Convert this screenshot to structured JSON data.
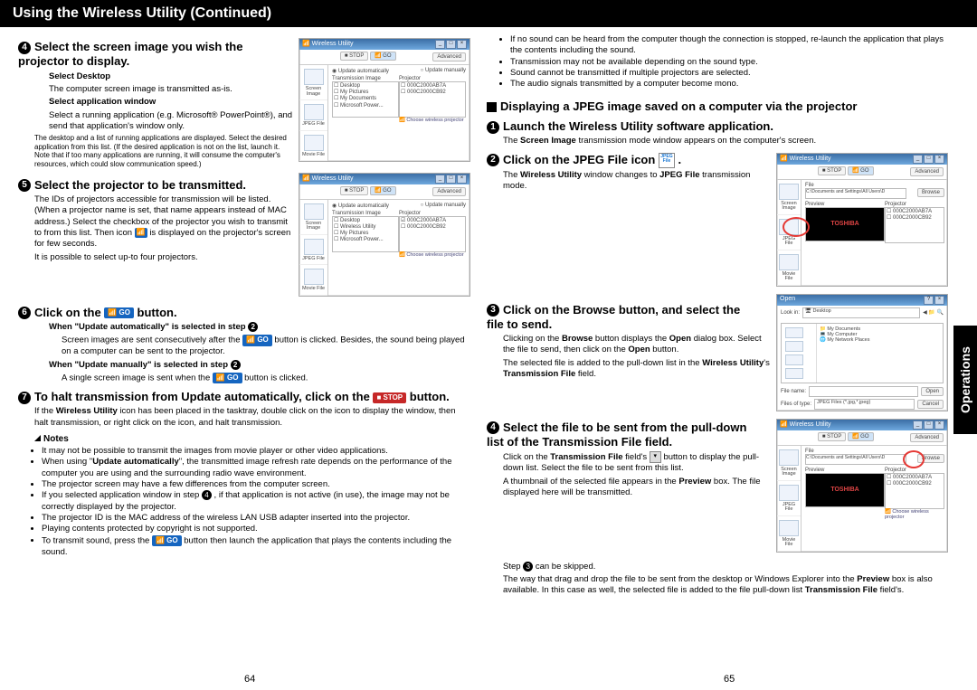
{
  "title": "Using the Wireless Utility (Continued)",
  "sideTab": "Operations",
  "pageLeft": "64",
  "pageRight": "65",
  "shot": {
    "title": "Wireless Utility",
    "btnStop": "■ STOP",
    "btnGo": "📶 GO",
    "btnAdv": "Advanced",
    "side1": "Screen Image",
    "side2": "JPEG File",
    "side3": "Movie File",
    "updateAuto": "Update automatically",
    "updateMan": "Update manually",
    "tiLabel": "Transmission Image",
    "prLabel": "Projector",
    "ti1": "Desktop",
    "ti2": "Wireless Utility",
    "ti3": "My Pictures",
    "ti4": "Microsoft Power...",
    "pr1": "000C2000AB7A",
    "pr2": "000C2000CB92",
    "choose": "Choose wireless projector",
    "fileLbl": "File",
    "filePath": "C:\\Documents and Settings\\All Users\\D",
    "browse": "Browse",
    "preview": "Preview",
    "toshiba": "TOSHIBA",
    "lookIn": "Look in:",
    "desktop": "Desktop",
    "myDocs": "My Documents",
    "myComp": "My Computer",
    "myNet": "My Network Places",
    "fileName": "File name:",
    "fileTypes": "Files of type:",
    "jpegFilt": "JPEG Files (*.jpg,*.jpeg)",
    "openBtn": "Open",
    "cancelBtn": "Cancel"
  },
  "left": {
    "s4": {
      "head": "Select the screen image you wish the projector to display.",
      "sd": "Select Desktop",
      "sdText": "The computer screen image is transmitted as-is.",
      "saw": "Select application window",
      "sawText": "Select a running application (e.g. Microsoft® PowerPoint®), and send that application's window only.",
      "note": "The desktop and a list of running applications are displayed. Select the desired application from this list. (If the desired application is not on the list, launch it. Note that if too many applications are running, it will consume the computer's resources, which could slow communication speed.)"
    },
    "s5": {
      "head": "Select the projector to be transmitted.",
      "text": "The IDs of projectors accessible for transmission will be listed. (When a projector name is set, that name appears instead of MAC address.) Select the checkbox of the projector you wish to transmit to from this list. Then icon",
      "text2": "is displayed on the projector's screen for few seconds.",
      "text3": "It is possible to select up-to four projectors."
    },
    "s6": {
      "head1": "Click on the ",
      "head2": " button.",
      "wa": "When \"Update automatically\" is selected in step ",
      "waText1": "Screen images are sent consecutively after the ",
      "waText2": " button is clicked. Besides, the sound being played on a computer can be sent to the projector.",
      "wm": "When \"Update manually\" is selected in step ",
      "wmText1": "A single screen image is sent when the ",
      "wmText2": " button is clicked."
    },
    "s7": {
      "head1": "To halt transmission from Update automatically, click on the ",
      "head2": " button.",
      "text": "If the Wireless Utility icon has been placed in the tasktray, double click on the icon to display the window, then halt transmission, or right click on the icon, and halt transmission."
    },
    "notesHead": "Notes",
    "notes": [
      "It may not be possible to transmit the images from movie player or other video applications.",
      "When using \"Update automatically\", the transmitted image refresh rate depends on the performance of the computer you are using and the surrounding radio wave environment.",
      "The projector screen may have a few differences from the computer screen.",
      "If you selected application window in step 4 , if that application is not active (in use), the image may not be correctly displayed by the projector.",
      "The projector ID is the MAC address of the wireless LAN USB adapter inserted into the projector.",
      "Playing contents protected by copyright is not supported.",
      "To transmit sound, press the [GO] button then launch the application that plays the contents including the sound."
    ]
  },
  "right": {
    "topBullets": [
      "If no sound can be heard from the computer though the connection is stopped, re-launch the application that plays the contents including the sound.",
      "Transmission may not be available depending on the sound type.",
      "Sound cannot be transmitted if multiple projectors are selected.",
      "The audio signals transmitted by a computer become mono."
    ],
    "sectionHead": "Displaying a JPEG image saved on a computer via the projector",
    "s1": {
      "head": "Launch the Wireless Utility software application.",
      "text": "The Screen Image transmission mode window appears on the computer's screen."
    },
    "s2": {
      "head1": "Click on the JPEG File icon ",
      "head2": " .",
      "text": "The Wireless Utility window changes to JPEG File transmission mode."
    },
    "s3": {
      "head": "Click on the Browse button, and select the file to send.",
      "t1a": "Clicking on the ",
      "t1b": "Browse",
      "t1c": " button displays the ",
      "t1d": "Open",
      "t1e": " dialog box. Select the file to send, then click on the ",
      "t1f": "Open",
      "t1g": " button.",
      "t2a": "The selected file is added to the pull-down list in the ",
      "t2b": "Wireless Utility",
      "t2c": "'s ",
      "t2d": "Transmission File",
      "t2e": " field."
    },
    "s4": {
      "head": "Select the file to be sent from the pull-down list of the Transmission File field.",
      "t1a": "Click on the ",
      "t1b": "Transmission File",
      "t1c": " field's ",
      "t1d": " button to display the pull-down list. Select the file to be sent from this list.",
      "t2a": "A thumbnail of the selected file appears in the ",
      "t2b": "Preview",
      "t2c": " box. The file displayed here will be transmitted.",
      "skip": "Step 3 can be skipped.",
      "t3a": "The way that drag and drop the file to be sent from the desktop or Windows Explorer into the ",
      "t3b": "Preview",
      "t3c": " box is also available. In this case as well, the selected file is added to the file pull-down list ",
      "t3d": "Transmission File",
      "t3e": " field's."
    }
  }
}
